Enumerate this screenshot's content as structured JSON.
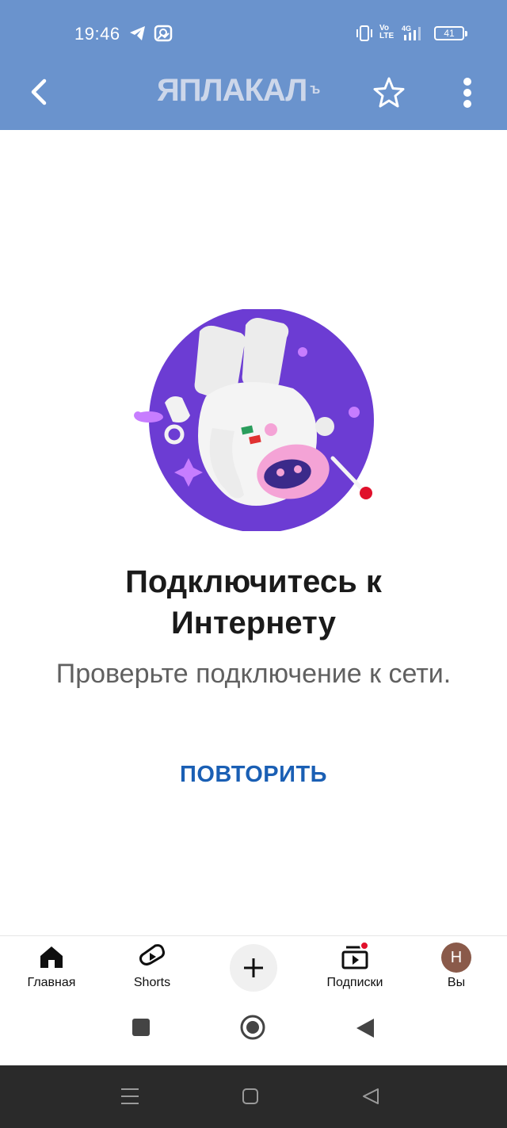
{
  "status_bar": {
    "time": "19:46",
    "battery": "41",
    "icons": [
      "telegram-icon",
      "gallery-notification-icon",
      "vibrate-icon",
      "volte-icon",
      "signal-4g-icon"
    ]
  },
  "toolbar": {
    "logo_text": "ЯПЛАКАЛ",
    "logo_sup": "ъ",
    "colors": {
      "background": "#6a93cd",
      "logo": "#cdd7ea"
    }
  },
  "error": {
    "title": "Подключитесь к Интернету",
    "subtitle": "Проверьте подключение к сети.",
    "retry_label": "ПОВТОРИТЬ",
    "colors": {
      "accent": "#1a5fb4",
      "illustration_bg": "#6c3cd3"
    }
  },
  "bottom_nav": {
    "items": [
      {
        "label": "Главная",
        "icon": "home-icon"
      },
      {
        "label": "Shorts",
        "icon": "shorts-icon"
      },
      {
        "label": "",
        "icon": "plus-icon"
      },
      {
        "label": "Подписки",
        "icon": "subscriptions-icon"
      },
      {
        "label": "Вы",
        "avatar_letter": "Н"
      }
    ]
  },
  "media_row": {
    "icons": [
      "stop-icon",
      "record-icon",
      "back-triangle-icon"
    ]
  },
  "system_nav": {
    "icons": [
      "menu-icon",
      "home-square-icon",
      "back-icon"
    ]
  }
}
